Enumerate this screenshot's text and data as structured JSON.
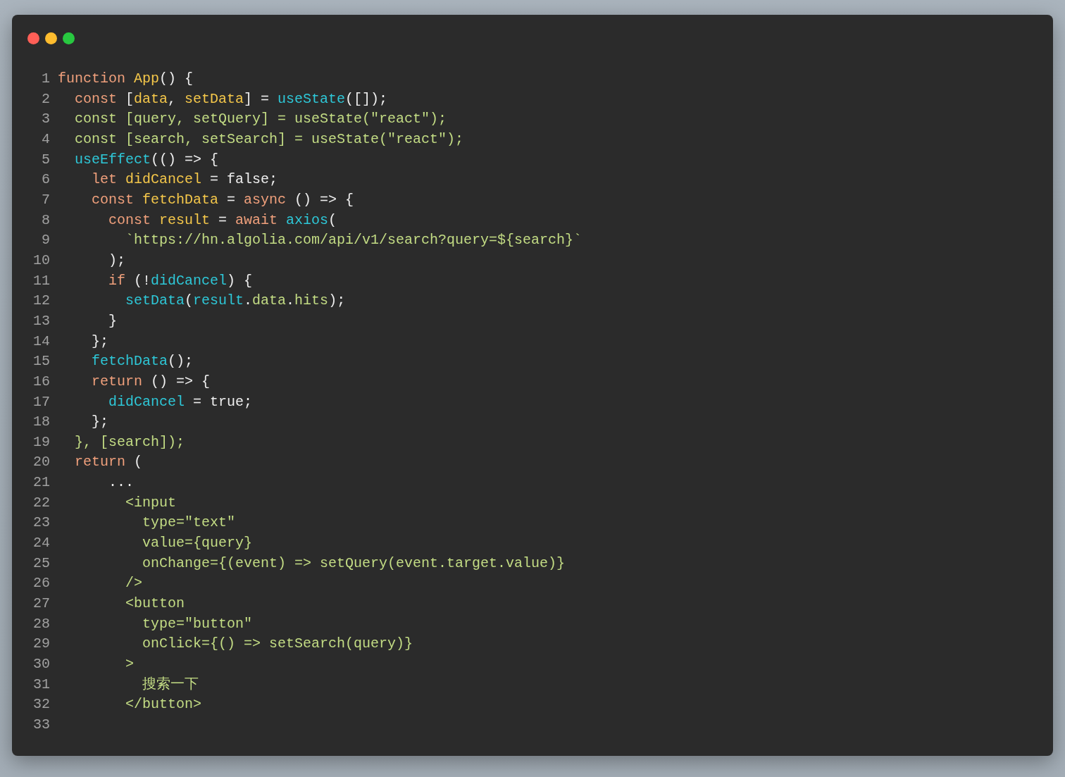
{
  "window": {
    "traffic_lights": [
      {
        "color": "#ff5f57"
      },
      {
        "color": "#febc2e"
      },
      {
        "color": "#28c840"
      }
    ]
  },
  "code": {
    "lines": [
      {
        "number": "1",
        "tokens": [
          {
            "text": "function ",
            "kind": "keyword"
          },
          {
            "text": "App",
            "kind": "variable"
          },
          {
            "text": "() {",
            "kind": "plain"
          }
        ]
      },
      {
        "number": "2",
        "tokens": [
          {
            "text": "  const",
            "kind": "keyword"
          },
          {
            "text": " [",
            "kind": "plain"
          },
          {
            "text": "data",
            "kind": "variable"
          },
          {
            "text": ", ",
            "kind": "plain"
          },
          {
            "text": "setData",
            "kind": "variable"
          },
          {
            "text": "] = ",
            "kind": "plain"
          },
          {
            "text": "useState",
            "kind": "call"
          },
          {
            "text": "([]);",
            "kind": "plain"
          }
        ]
      },
      {
        "number": "3",
        "tokens": [
          {
            "text": "  const [query, setQuery] = useState(\"react\");",
            "kind": "string"
          }
        ]
      },
      {
        "number": "4",
        "tokens": [
          {
            "text": "  const [search, setSearch] = useState(\"react\");",
            "kind": "string"
          }
        ]
      },
      {
        "number": "5",
        "tokens": [
          {
            "text": "  useEffect",
            "kind": "call"
          },
          {
            "text": "(() => {",
            "kind": "plain"
          }
        ]
      },
      {
        "number": "6",
        "tokens": [
          {
            "text": "    let ",
            "kind": "keyword"
          },
          {
            "text": "didCancel",
            "kind": "variable"
          },
          {
            "text": " = false;",
            "kind": "plain"
          }
        ]
      },
      {
        "number": "7",
        "tokens": [
          {
            "text": "    const ",
            "kind": "keyword"
          },
          {
            "text": "fetchData",
            "kind": "variable"
          },
          {
            "text": " = ",
            "kind": "plain"
          },
          {
            "text": "async",
            "kind": "keyword"
          },
          {
            "text": " () => {",
            "kind": "plain"
          }
        ]
      },
      {
        "number": "8",
        "tokens": [
          {
            "text": "      const ",
            "kind": "keyword"
          },
          {
            "text": "result",
            "kind": "variable"
          },
          {
            "text": " = ",
            "kind": "plain"
          },
          {
            "text": "await ",
            "kind": "keyword"
          },
          {
            "text": "axios",
            "kind": "call"
          },
          {
            "text": "(",
            "kind": "plain"
          }
        ]
      },
      {
        "number": "9",
        "tokens": [
          {
            "text": "        `https://hn.algolia.com/api/v1/search?query=${search}`",
            "kind": "string"
          }
        ]
      },
      {
        "number": "10",
        "tokens": [
          {
            "text": "      );",
            "kind": "plain"
          }
        ]
      },
      {
        "number": "11",
        "tokens": [
          {
            "text": "      if",
            "kind": "keyword"
          },
          {
            "text": " (!",
            "kind": "plain"
          },
          {
            "text": "didCancel",
            "kind": "call"
          },
          {
            "text": ") {",
            "kind": "plain"
          }
        ]
      },
      {
        "number": "12",
        "tokens": [
          {
            "text": "        setData",
            "kind": "call"
          },
          {
            "text": "(",
            "kind": "plain"
          },
          {
            "text": "result",
            "kind": "call"
          },
          {
            "text": ".",
            "kind": "plain"
          },
          {
            "text": "data",
            "kind": "string"
          },
          {
            "text": ".",
            "kind": "plain"
          },
          {
            "text": "hits",
            "kind": "string"
          },
          {
            "text": ");",
            "kind": "plain"
          }
        ]
      },
      {
        "number": "13",
        "tokens": [
          {
            "text": "      }",
            "kind": "plain"
          }
        ]
      },
      {
        "number": "14",
        "tokens": [
          {
            "text": "    };",
            "kind": "plain"
          }
        ]
      },
      {
        "number": "15",
        "tokens": [
          {
            "text": "    fetchData",
            "kind": "call"
          },
          {
            "text": "();",
            "kind": "plain"
          }
        ]
      },
      {
        "number": "16",
        "tokens": [
          {
            "text": "    return",
            "kind": "keyword"
          },
          {
            "text": " () => {",
            "kind": "plain"
          }
        ]
      },
      {
        "number": "17",
        "tokens": [
          {
            "text": "      didCancel",
            "kind": "call"
          },
          {
            "text": " = true;",
            "kind": "plain"
          }
        ]
      },
      {
        "number": "18",
        "tokens": [
          {
            "text": "    };",
            "kind": "plain"
          }
        ]
      },
      {
        "number": "19",
        "tokens": [
          {
            "text": "  }, [search]);",
            "kind": "string"
          }
        ]
      },
      {
        "number": "20",
        "tokens": [
          {
            "text": "  return",
            "kind": "keyword"
          },
          {
            "text": " (",
            "kind": "plain"
          }
        ]
      },
      {
        "number": "21",
        "tokens": [
          {
            "text": "      ...",
            "kind": "plain"
          }
        ]
      },
      {
        "number": "22",
        "tokens": [
          {
            "text": "        <input",
            "kind": "string"
          }
        ]
      },
      {
        "number": "23",
        "tokens": [
          {
            "text": "          type=\"text\"",
            "kind": "string"
          }
        ]
      },
      {
        "number": "24",
        "tokens": [
          {
            "text": "          value={query}",
            "kind": "string"
          }
        ]
      },
      {
        "number": "25",
        "tokens": [
          {
            "text": "          onChange={(event) => setQuery(event.target.value)}",
            "kind": "string"
          }
        ]
      },
      {
        "number": "26",
        "tokens": [
          {
            "text": "        />",
            "kind": "string"
          }
        ]
      },
      {
        "number": "27",
        "tokens": [
          {
            "text": "        <button",
            "kind": "string"
          }
        ]
      },
      {
        "number": "28",
        "tokens": [
          {
            "text": "          type=\"button\"",
            "kind": "string"
          }
        ]
      },
      {
        "number": "29",
        "tokens": [
          {
            "text": "          onClick={() => setSearch(query)}",
            "kind": "string"
          }
        ]
      },
      {
        "number": "30",
        "tokens": [
          {
            "text": "        >",
            "kind": "string"
          }
        ]
      },
      {
        "number": "31",
        "tokens": [
          {
            "text": "          搜索一下",
            "kind": "string"
          }
        ]
      },
      {
        "number": "32",
        "tokens": [
          {
            "text": "        </button>",
            "kind": "string"
          }
        ]
      },
      {
        "number": "33"
      }
    ]
  }
}
